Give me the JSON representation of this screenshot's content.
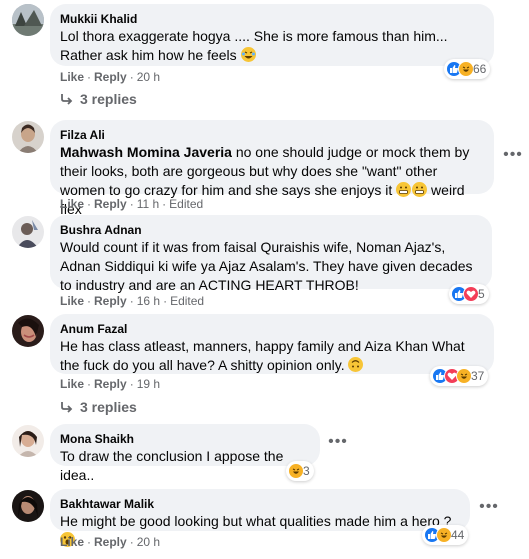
{
  "actions": {
    "like": "Like",
    "reply": "Reply",
    "edited": "Edited"
  },
  "more_glyph": "•••",
  "comments": [
    {
      "author": "Mukkii Khalid",
      "text": "Lol thora exaggerate hogya .... She is more famous than him... Rather ask him how he feels",
      "time": "20 h",
      "reactions": {
        "icons": [
          "like-icon",
          "laugh-icon"
        ],
        "count": "66"
      },
      "replies": "3 replies"
    },
    {
      "author": "Filza Ali",
      "mention": "Mahwash Momina Javeria",
      "text": " no one should judge or mock them by their looks, both are gorgeous but why does she \"want\" other women to go crazy for him and she says she enjoys it",
      "text_tail": " weird flex",
      "time": "11 h",
      "edited": true
    },
    {
      "author": "Bushra Adnan",
      "text": "Would count if it was from faisal Quraishis wife, Noman Ajaz's, Adnan Siddiqui ki wife ya Ajaz Asalam's. They have given decades to industry and are an ACTING HEART THROB!",
      "time": "16 h",
      "edited": true,
      "reactions": {
        "icons": [
          "like-icon",
          "love-icon"
        ],
        "count": "5"
      }
    },
    {
      "author": "Anum Fazal",
      "text": "He has class atleast, manners, happy family and Aiza Khan What the fuck do you all have? A shitty opinion only.",
      "time": "19 h",
      "reactions": {
        "icons": [
          "like-icon",
          "love-icon",
          "laugh-icon"
        ],
        "count": "37"
      },
      "replies": "3 replies"
    },
    {
      "author": "Mona Shaikh",
      "text": "To draw the conclusion I appose the idea..",
      "reactions": {
        "icons": [
          "laugh-icon"
        ],
        "count": "3"
      }
    },
    {
      "author": "Bakhtawar Malik",
      "text": "He might be good looking but what qualities made him a hero ?",
      "time": "20 h",
      "reactions": {
        "icons": [
          "like-icon",
          "laugh-icon"
        ],
        "count": "44"
      }
    }
  ]
}
